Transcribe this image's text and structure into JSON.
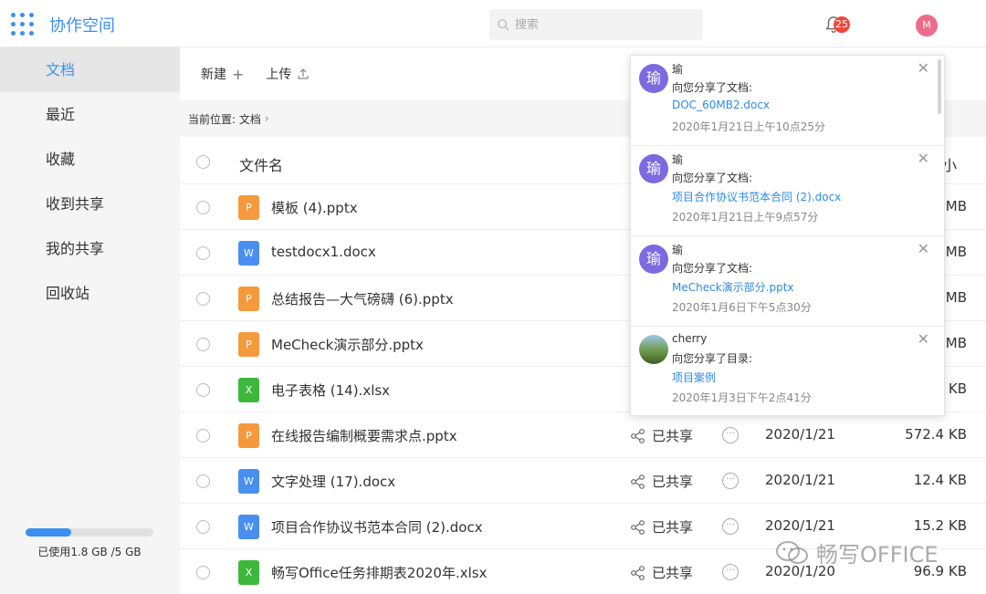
{
  "app": {
    "title": "协作空间"
  },
  "search": {
    "placeholder": "搜索"
  },
  "notifications_badge": "25",
  "user_avatar": "M",
  "sidebar": {
    "items": [
      {
        "label": "文档",
        "active": true
      },
      {
        "label": "最近"
      },
      {
        "label": "收藏"
      },
      {
        "label": "收到共享"
      },
      {
        "label": "我的共享"
      },
      {
        "label": "回收站"
      }
    ],
    "storage": {
      "text": "已使用1.8 GB /5 GB",
      "used_fraction": 0.36
    }
  },
  "toolbar": {
    "new_label": "新建",
    "upload_label": "上传"
  },
  "breadcrumb": {
    "label": "当前位置: 文档"
  },
  "table": {
    "header_name": "文件名",
    "header_size": "小",
    "rows": [
      {
        "type": "P",
        "name": "模板 (4).pptx",
        "share": "",
        "date": "",
        "size": "MB"
      },
      {
        "type": "W",
        "name": "testdocx1.docx",
        "share": "",
        "date": "",
        "size": "MB"
      },
      {
        "type": "P",
        "name": "总结报告—大气磅礴 (6).pptx",
        "share": "",
        "date": "",
        "size": "MB"
      },
      {
        "type": "P",
        "name": "MeCheck演示部分.pptx",
        "share": "",
        "date": "",
        "size": "MB"
      },
      {
        "type": "X",
        "name": "电子表格 (14).xlsx",
        "share": "",
        "date": "",
        "size": "KB"
      },
      {
        "type": "P",
        "name": "在线报告编制概要需求点.pptx",
        "share": "已共享",
        "date": "2020/1/21",
        "size": "572.4 KB"
      },
      {
        "type": "W",
        "name": "文字处理 (17).docx",
        "share": "已共享",
        "date": "2020/1/21",
        "size": "12.4 KB"
      },
      {
        "type": "W",
        "name": "项目合作协议书范本合同 (2).docx",
        "share": "已共享",
        "date": "2020/1/21",
        "size": "15.2 KB"
      },
      {
        "type": "X",
        "name": "畅写Office任务排期表2020年.xlsx",
        "share": "已共享",
        "date": "2020/1/20",
        "size": "96.9 KB"
      }
    ]
  },
  "notifications": [
    {
      "avatar": "瑜",
      "user": "瑜",
      "action": "向您分享了文档:",
      "link": "DOC_60MB2.docx",
      "time": "2020年1月21日上午10点25分"
    },
    {
      "avatar": "瑜",
      "user": "瑜",
      "action": "向您分享了文档:",
      "link": "项目合作协议书范本合同 (2).docx",
      "time": "2020年1月21日上午9点57分"
    },
    {
      "avatar": "瑜",
      "user": "瑜",
      "action": "向您分享了文档:",
      "link": "MeCheck演示部分.pptx",
      "time": "2020年1月6日下午5点30分"
    },
    {
      "avatar": "",
      "user": "cherry",
      "action": "向您分享了目录:",
      "link": "项目案例",
      "time": "2020年1月3日下午2点41分"
    }
  ],
  "watermark": "畅写OFFICE",
  "colors": {
    "accent": "#3b8ff0",
    "ppt": "#f59a3c",
    "word": "#4a8ff0",
    "excel": "#3db83d",
    "badge": "#f2463d"
  }
}
